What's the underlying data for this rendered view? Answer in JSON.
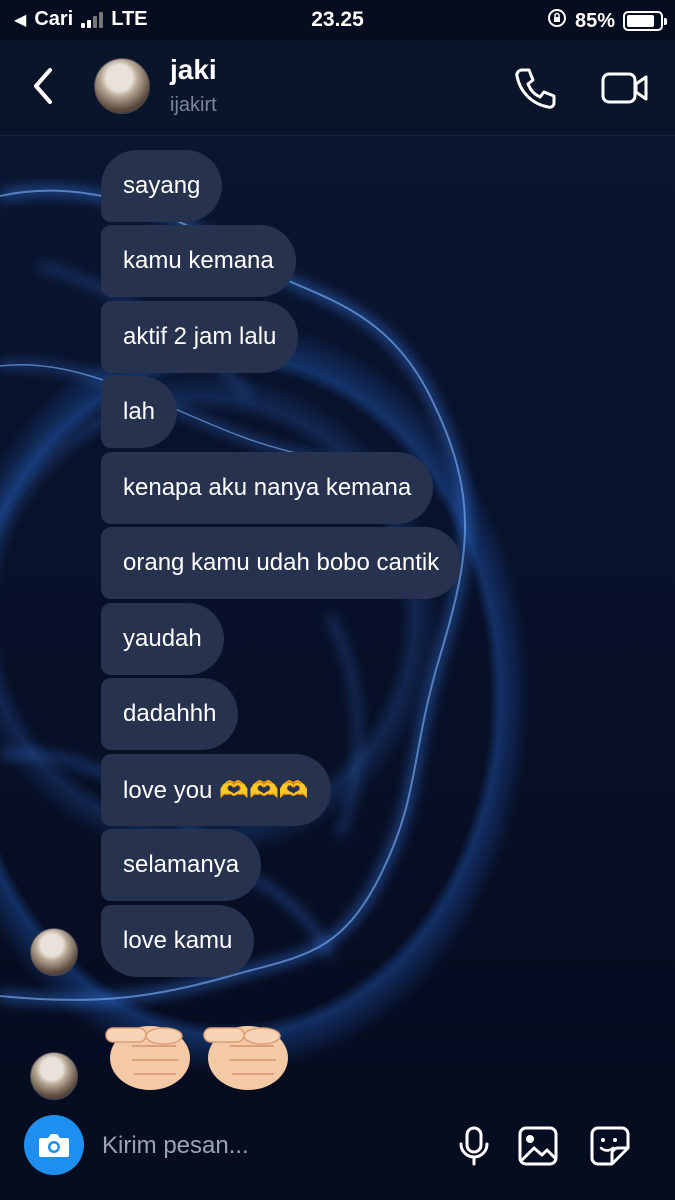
{
  "status_bar": {
    "carrier": "Cari",
    "network": "LTE",
    "time": "23.25",
    "battery": "85%",
    "battery_level": 0.85
  },
  "header": {
    "name": "jaki",
    "username": "ijakirt",
    "back_icon": "chevron-left-icon",
    "call_icon": "phone-icon",
    "video_icon": "video-camera-icon"
  },
  "messages": [
    {
      "text": "sayang"
    },
    {
      "text": "kamu kemana"
    },
    {
      "text": "aktif 2 jam lalu"
    },
    {
      "text": "lah"
    },
    {
      "text": "kenapa aku nanya kemana"
    },
    {
      "text": "orang kamu udah bobo cantik"
    },
    {
      "text": "yaudah"
    },
    {
      "text": "dadahhh"
    },
    {
      "text": "love you 🫶🫶🫶"
    },
    {
      "text": "selamanya"
    },
    {
      "text": "love kamu"
    }
  ],
  "emoji_message": {
    "emoji": "👉👉",
    "icon": "pointing-fist-icon"
  },
  "composer": {
    "placeholder": "Kirim pesan...",
    "camera_icon": "camera-icon",
    "mic_icon": "microphone-icon",
    "gallery_icon": "image-icon",
    "sticker_icon": "sticker-icon"
  },
  "colors": {
    "background": "#070d20",
    "bubble": "#26324e",
    "accent": "#1e8ff0"
  }
}
